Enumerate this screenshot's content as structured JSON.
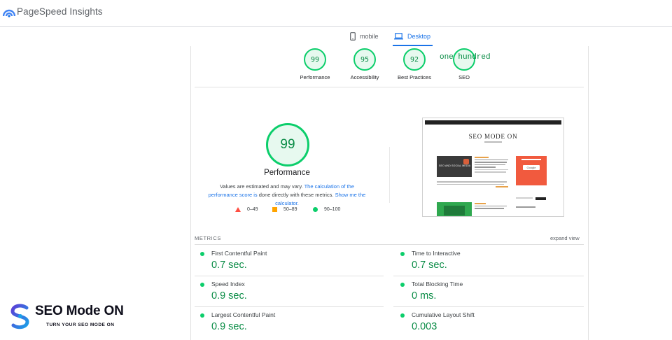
{
  "header": {
    "brand": "PageSpeed Insights",
    "logo_icon": "pagespeed-logo-icon"
  },
  "device_tabs": [
    {
      "label": "mobile",
      "icon": "phone-icon",
      "active": false
    },
    {
      "label": "Desktop",
      "icon": "laptop-icon",
      "active": true
    }
  ],
  "category_scores": [
    {
      "score": "99",
      "label": "Performance"
    },
    {
      "score": "95",
      "label": "Accessibility"
    },
    {
      "score": "92",
      "label": "Best Practices"
    },
    {
      "score": "",
      "label": "SEO"
    }
  ],
  "seo_score_overlay": "one hundred",
  "performance": {
    "score": "99",
    "title": "Performance",
    "note_prefix": "Values are estimated and may vary.",
    "note_link": "The calculation of the performance score is",
    "note_middle": "done directly with these metrics.",
    "note_link2": "Show me the calculator."
  },
  "legend": [
    {
      "label": "0–49",
      "color": "#ff4e42",
      "shape": "triangle"
    },
    {
      "label": "50–89",
      "color": "#ffa400",
      "shape": "square"
    },
    {
      "label": "90–100",
      "color": "#0cce6b",
      "shape": "circle"
    }
  ],
  "screenshot_preview": {
    "site_title": "SEO MODE ON",
    "thumb_caption": "SEO AND SOCIAL MEDIA",
    "widget_label": "Google"
  },
  "metrics": {
    "heading": "METRICS",
    "expand_label": "expand view",
    "items": [
      {
        "name": "First Contentful Paint",
        "value": "0.7 sec."
      },
      {
        "name": "Time to Interactive",
        "value": "0.7 sec."
      },
      {
        "name": "Speed Index",
        "value": "0.9 sec."
      },
      {
        "name": "Total Blocking Time",
        "value": "0 ms."
      },
      {
        "name": "Largest Contentful Paint",
        "value": "0.9 sec."
      },
      {
        "name": "Cumulative Layout Shift",
        "value": "0.003"
      }
    ]
  },
  "promo": {
    "name": "SEO Mode ON",
    "tagline": "TURN YOUR SEO MODE ON"
  },
  "colors": {
    "pass": "#0cce6b",
    "pass_text": "#0a8c46",
    "accent": "#1a73e8"
  }
}
